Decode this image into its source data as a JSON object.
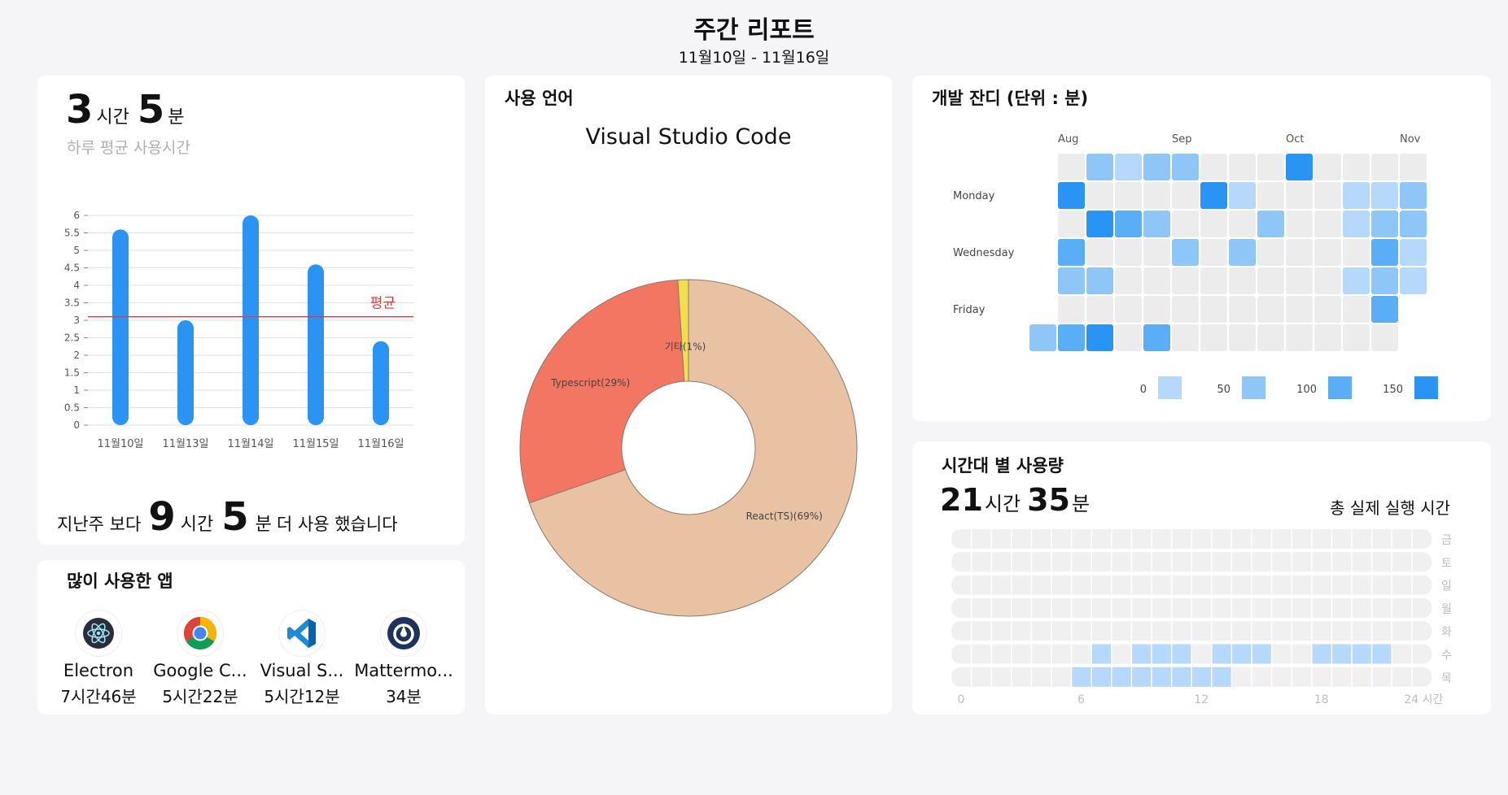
{
  "header": {
    "title": "주간 리포트",
    "subtitle": "11월10일 - 11월16일"
  },
  "daily": {
    "avg_hours": "3",
    "hours_unit": "시간",
    "avg_minutes": "5",
    "minutes_unit": "분",
    "avg_label": "하루 평균 사용시간",
    "compare": {
      "prefix": "지난주 보다",
      "hours": "9",
      "hours_unit": "시간",
      "minutes": "5",
      "minutes_unit": "분",
      "suffix": "더 사용 했습니다"
    }
  },
  "top_apps": {
    "title": "많이 사용한 앱",
    "items": [
      {
        "name": "Electron",
        "time": "7시간46분",
        "icon": "electron-icon"
      },
      {
        "name": "Google C...",
        "time": "5시간22분",
        "icon": "chrome-icon"
      },
      {
        "name": "Visual S...",
        "time": "5시간12분",
        "icon": "vscode-icon"
      },
      {
        "name": "Mattermo...",
        "time": "34분",
        "icon": "mattermost-icon"
      }
    ]
  },
  "languages": {
    "title": "사용 언어"
  },
  "grass": {
    "title": "개발 잔디 (단위 : 분)",
    "months": [
      "Aug",
      "Sep",
      "Oct",
      "Nov"
    ],
    "days": [
      "Monday",
      "Wednesday",
      "Friday"
    ],
    "legend": [
      "0",
      "50",
      "100",
      "150"
    ],
    "colors": [
      "#ececec",
      "#b6d8fa",
      "#8ec6f7",
      "#5aaef6",
      "#2a94f4"
    ],
    "grid": [
      [
        -1,
        0,
        2,
        1,
        2,
        2,
        0,
        0,
        0,
        4,
        0,
        0,
        0,
        0
      ],
      [
        -1,
        4,
        0,
        0,
        0,
        0,
        4,
        1,
        0,
        0,
        0,
        1,
        1,
        2
      ],
      [
        -1,
        0,
        4,
        3,
        2,
        0,
        0,
        0,
        2,
        0,
        0,
        1,
        2,
        2
      ],
      [
        -1,
        3,
        0,
        0,
        0,
        2,
        0,
        2,
        0,
        0,
        0,
        0,
        3,
        1
      ],
      [
        -1,
        2,
        2,
        0,
        0,
        0,
        0,
        0,
        0,
        0,
        0,
        1,
        2,
        1
      ],
      [
        -1,
        0,
        0,
        0,
        0,
        0,
        0,
        0,
        0,
        0,
        0,
        0,
        3,
        -1
      ],
      [
        2,
        3,
        4,
        0,
        3,
        0,
        0,
        0,
        0,
        0,
        0,
        0,
        0,
        -1
      ]
    ]
  },
  "hourly": {
    "title": "시간대 별 사용량",
    "hours": "21",
    "hours_unit": "시간",
    "minutes": "35",
    "minutes_unit": "분",
    "caption": "총 실제 실행 시간",
    "days": [
      "금",
      "토",
      "일",
      "월",
      "화",
      "수",
      "목"
    ],
    "x_ticks": [
      "0",
      "6",
      "12",
      "18",
      "24 시간"
    ],
    "active": [
      [],
      [],
      [],
      [],
      [],
      [
        7,
        9,
        10,
        11,
        13,
        14,
        15,
        18,
        19,
        20,
        21
      ],
      [
        6,
        7,
        8,
        9,
        10,
        11,
        12,
        13
      ]
    ],
    "active_color": "#b6d8fa",
    "inactive_color": "#f0f0f0"
  },
  "chart_data": [
    {
      "type": "bar",
      "categories": [
        "11월10일",
        "11월13일",
        "11월14일",
        "11월15일",
        "11월16일"
      ],
      "values": [
        5.6,
        3.0,
        6.0,
        4.6,
        2.4
      ],
      "ylim": [
        0,
        6
      ],
      "yticks": [
        "0",
        "0.5",
        "1",
        "1.5",
        "2",
        "2.5",
        "3",
        "3.5",
        "4",
        "4.5",
        "5",
        "5.5",
        "6"
      ],
      "average": 3.1,
      "average_label": "평균",
      "color": "#2a94f4",
      "average_color": "#e53935",
      "grid": true
    },
    {
      "type": "pie",
      "title": "Visual Studio Code",
      "slices": [
        {
          "label": "React(TS)(69%)",
          "value": 69,
          "color": "#e8c2a3"
        },
        {
          "label": "Typescript(29%)",
          "value": 29,
          "color": "#f27662"
        },
        {
          "label": "기타(1%)",
          "value": 1,
          "color": "#f2df4e"
        }
      ]
    }
  ]
}
